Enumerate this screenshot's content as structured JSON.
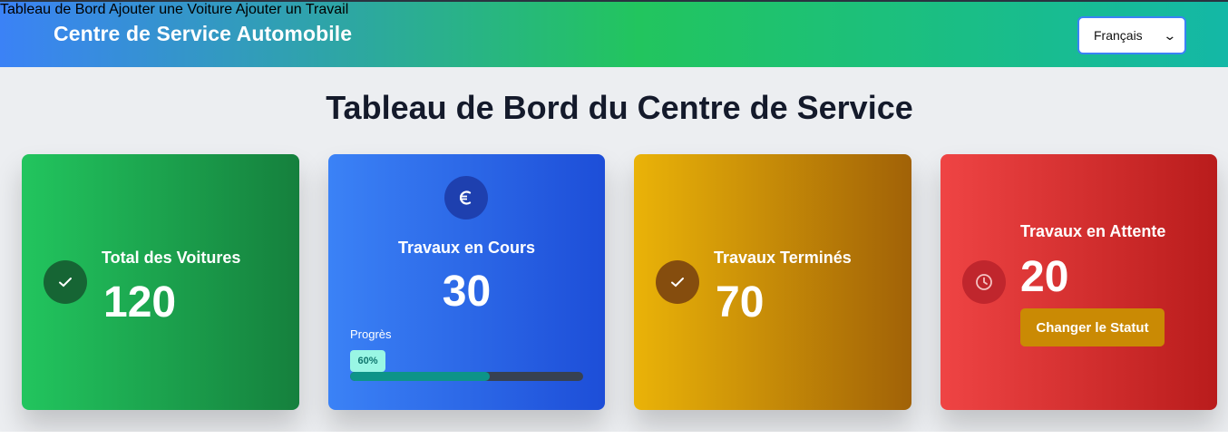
{
  "header": {
    "brand": "Centre de Service Automobile",
    "nav": [
      "Tableau de Bord",
      "Ajouter une Voiture",
      "Ajouter un Travail"
    ],
    "language": {
      "selected": "Français"
    }
  },
  "page": {
    "title": "Tableau de Bord du Centre de Service"
  },
  "cards": [
    {
      "label": "Total des Voitures",
      "value": "120",
      "icon": "check-icon"
    },
    {
      "label": "Travaux en Cours",
      "value": "30",
      "icon": "euro-icon",
      "progress_label": "Progrès",
      "progress_text": "60%",
      "progress": 0.6
    },
    {
      "label": "Travaux Terminés",
      "value": "70",
      "icon": "check-icon"
    },
    {
      "label": "Travaux en Attente",
      "value": "20",
      "icon": "clock-icon",
      "button": "Changer le Statut"
    }
  ],
  "colors": {
    "green": "#22c55e",
    "blue": "#3b82f6",
    "yellow": "#eab308",
    "red": "#ef4444"
  }
}
